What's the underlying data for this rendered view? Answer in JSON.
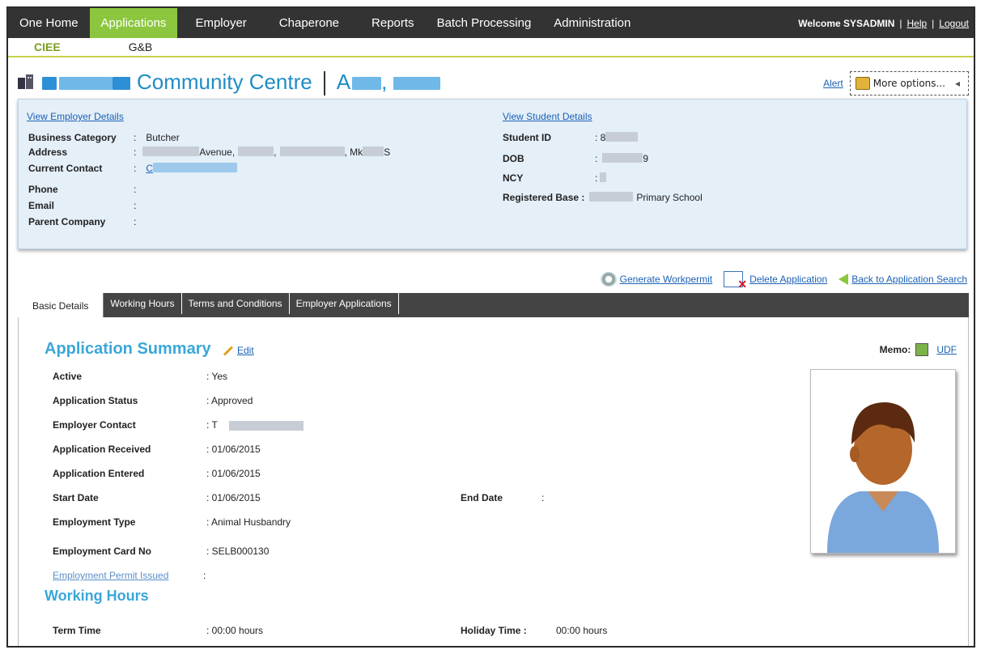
{
  "nav": {
    "items": [
      "One Home",
      "Applications",
      "Employer",
      "Chaperone",
      "Reports",
      "Batch Processing",
      "Administration"
    ],
    "welcome": "Welcome SYSADMIN",
    "help": "Help",
    "logout": "Logout",
    "separator": "|"
  },
  "subnav": {
    "ciee": "CIEE",
    "gb": "G&B"
  },
  "header": {
    "title_part": "Community Centre",
    "student_initial": "A",
    "comma": ",",
    "alert": "Alert",
    "more_options": "More options..."
  },
  "employer": {
    "link": "View Employer Details",
    "business_category_label": "Business Category",
    "business_category": "Butcher",
    "address_label": "Address",
    "address_avenue": "Avenue,",
    "address_mk": ", Mk",
    "address_end": "S",
    "current_contact_label": "Current Contact",
    "current_contact_initial": "C",
    "phone_label": "Phone",
    "email_label": "Email",
    "parent_company_label": "Parent Company",
    "colon": ":"
  },
  "student": {
    "link": "View Student Details",
    "student_id_label": "Student ID",
    "student_id_partial": ": 8",
    "dob_label": "DOB",
    "dob_end": "9",
    "ncy_label": "NCY",
    "registered_base_label": "Registered Base :",
    "registered_base": "Primary School"
  },
  "actions": {
    "generate": "Generate Workpermit",
    "delete": "Delete Application",
    "back": "Back to Application Search"
  },
  "tabs": [
    "Basic Details",
    "Working Hours",
    "Terms and Conditions",
    "Employer Applications"
  ],
  "summary": {
    "title": "Application Summary",
    "edit": "Edit",
    "memo": "Memo:",
    "udf": "UDF",
    "active_label": "Active",
    "active": ": Yes",
    "status_label": "Application Status",
    "status": ": Approved",
    "employer_contact_label": "Employer Contact",
    "employer_contact": ":  T",
    "received_label": "Application Received",
    "received": ": 01/06/2015",
    "entered_label": "Application Entered",
    "entered": ": 01/06/2015",
    "start_label": "Start Date",
    "start": ": 01/06/2015",
    "end_label": "End Date",
    "end": ":",
    "emp_type_label": "Employment Type",
    "emp_type": ": Animal Husbandry",
    "card_label": "Employment Card No",
    "card": ": SELB000130",
    "permit_label": "Employment Permit Issued",
    "permit": ":"
  },
  "working_hours": {
    "title": "Working Hours",
    "term_label": "Term Time",
    "term": ": 00:00 hours",
    "holiday_label": "Holiday Time :",
    "holiday": "00:00 hours"
  }
}
